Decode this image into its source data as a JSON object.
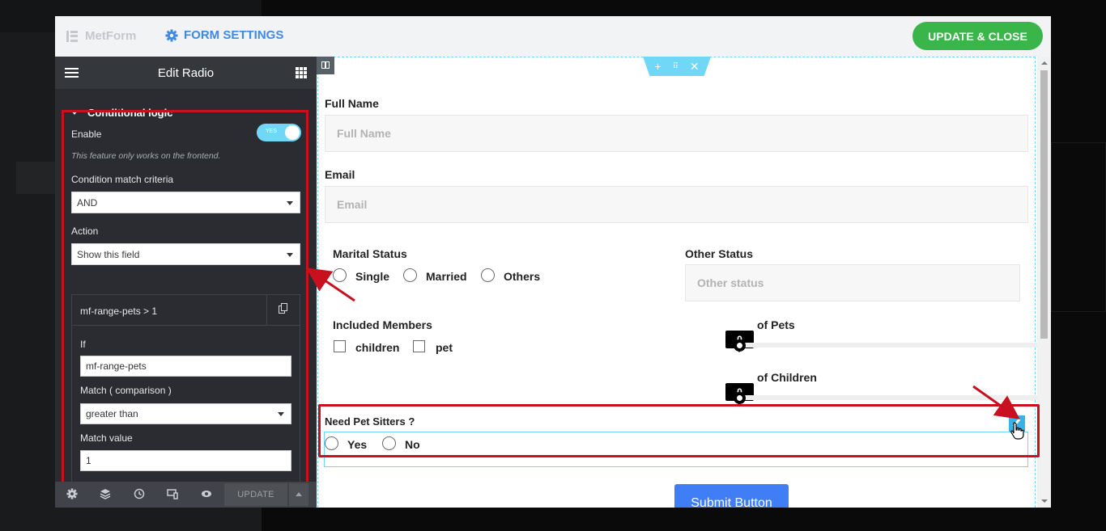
{
  "brand": {
    "name": "MetForm"
  },
  "header": {
    "form_settings": "FORM SETTINGS",
    "update_close": "UPDATE & CLOSE"
  },
  "panel": {
    "title": "Edit Radio",
    "section": "Conditional logic",
    "enable_label": "Enable",
    "toggle_text": "YES",
    "note": "This feature only works on the frontend.",
    "criteria_label": "Condition match criteria",
    "criteria_value": "AND",
    "action_label": "Action",
    "action_value": "Show this field",
    "condition": {
      "title": "mf-range-pets > 1",
      "if_label": "If",
      "if_value": "mf-range-pets",
      "match_label": "Match ( comparison )",
      "match_value": "greater than",
      "match_value_label": "Match value",
      "match_value_value": "1"
    },
    "footer": {
      "update": "UPDATE"
    }
  },
  "form": {
    "full_name": {
      "label": "Full Name",
      "placeholder": "Full Name"
    },
    "email": {
      "label": "Email",
      "placeholder": "Email"
    },
    "marital_status": {
      "label": "Marital Status",
      "options": [
        "Single",
        "Married",
        "Others"
      ]
    },
    "other_status": {
      "label": "Other Status",
      "placeholder": "Other status"
    },
    "included_members": {
      "label": "Included Members",
      "options": [
        "children",
        "pet"
      ]
    },
    "pets_range": {
      "label": "of Pets",
      "value": "0"
    },
    "children_range": {
      "label": "of Children",
      "value": "0"
    },
    "pet_sitters": {
      "label": "Need Pet Sitters ?",
      "options": [
        "Yes",
        "No"
      ]
    },
    "submit": "Submit Button"
  },
  "colors": {
    "accent": "#3f8ae0",
    "update_close": "#39b54a",
    "highlight": "#c8101e",
    "submit": "#3f7ef4",
    "editor_cyan": "#71d7f7"
  }
}
